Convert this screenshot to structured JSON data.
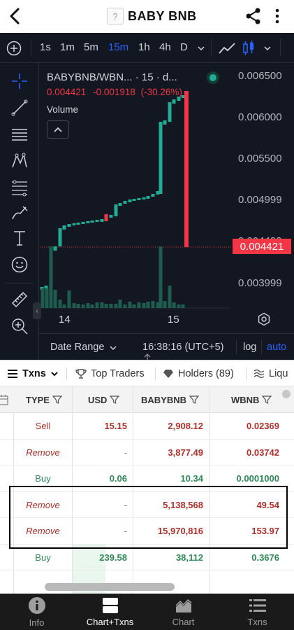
{
  "header": {
    "token_logo_glyph": "?",
    "token_name": "BABY BNB",
    "back_icon": "chevron-left-icon",
    "share_icon": "share-icon",
    "more_icon": "more-vertical-icon"
  },
  "chart_toolbar": {
    "intervals": [
      "1s",
      "1m",
      "5m",
      "15m",
      "1h",
      "4h",
      "D"
    ],
    "active_interval": "15m"
  },
  "chart": {
    "symbol_label": "BABYBNB/WBN... · 15 · d...",
    "last_price": "0.004421",
    "change": "-0.001918",
    "change_pct": "(-30.26%)",
    "volume_label": "Volume",
    "price_tag": "0.004421",
    "price_axis": [
      "0.006500",
      "0.006000",
      "0.005500",
      "0.004999",
      "0.004499",
      "0.003999"
    ],
    "time_axis": [
      "14",
      "15"
    ],
    "footer": {
      "date_range": "Date Range",
      "clock": "16:38:16 (UTC+5)",
      "log": "log",
      "auto": "auto"
    },
    "colors": {
      "up": "#22ab94",
      "down": "#f23645",
      "accent": "#2962ff"
    }
  },
  "tabs": [
    {
      "label": "Txns",
      "active": true
    },
    {
      "label": "Top Traders",
      "active": false
    },
    {
      "label": "Holders (89)",
      "active": false
    },
    {
      "label": "Liqu",
      "active": false
    }
  ],
  "table": {
    "columns": [
      "TYPE",
      "USD",
      "BABYBNB",
      "WBNB"
    ],
    "rows": [
      {
        "type": "Sell",
        "usd": "15.15",
        "babybnb": "2,908.12",
        "wbnb": "0.02369",
        "kind": "sell"
      },
      {
        "type": "Remove",
        "usd": "-",
        "babybnb": "3,877.49",
        "wbnb": "0.03742",
        "kind": "remove"
      },
      {
        "type": "Buy",
        "usd": "0.06",
        "babybnb": "10.34",
        "wbnb": "0.0001000",
        "kind": "buy"
      },
      {
        "type": "Remove",
        "usd": "-",
        "babybnb": "5,138,568",
        "wbnb": "49.54",
        "kind": "remove"
      },
      {
        "type": "Remove",
        "usd": "-",
        "babybnb": "15,970,816",
        "wbnb": "153.97",
        "kind": "remove"
      },
      {
        "type": "Buy",
        "usd": "239.58",
        "babybnb": "38,112",
        "wbnb": "0.3676",
        "kind": "buy"
      }
    ]
  },
  "bottom_nav": [
    {
      "label": "Info",
      "icon": "info-icon",
      "active": false
    },
    {
      "label": "Chart+Txns",
      "icon": "chart-txns-icon",
      "active": true
    },
    {
      "label": "Chart",
      "icon": "area-chart-icon",
      "active": false
    },
    {
      "label": "Txns",
      "icon": "list-icon",
      "active": false
    }
  ]
}
